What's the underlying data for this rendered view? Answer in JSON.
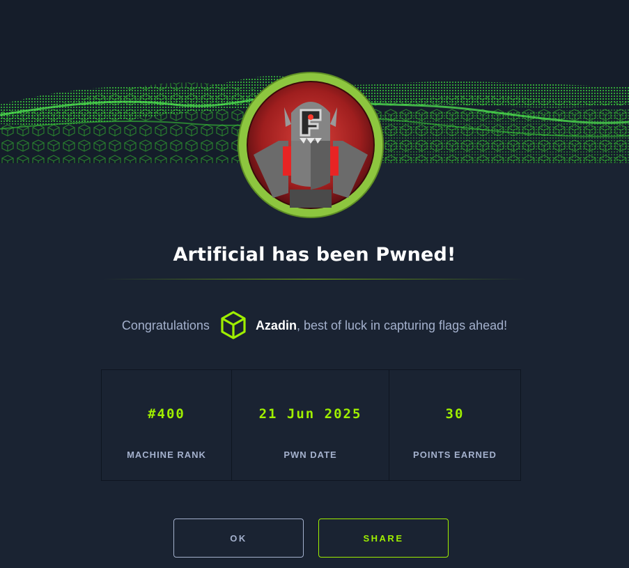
{
  "modal": {
    "title": "Artificial has been Pwned!",
    "congrats_prefix": "Congratulations",
    "username": "Azadin",
    "congrats_suffix": ", best of luck in capturing flags ahead!",
    "stats": [
      {
        "value": "#400",
        "label": "MACHINE RANK"
      },
      {
        "value": "21 Jun 2025",
        "label": "PWN DATE"
      },
      {
        "value": "30",
        "label": "POINTS EARNED"
      }
    ],
    "buttons": {
      "ok_label": "OK",
      "share_label": "SHARE"
    }
  },
  "icons": {
    "banner": "green-cube-wave-banner",
    "avatar": "robot-machine-avatar",
    "user_badge": "green-cube-icon"
  },
  "colors": {
    "background": "#1a2332",
    "accent_green": "#9fef00",
    "muted_text": "#a4b1cd",
    "avatar_ring": "#8dc63f",
    "avatar_inner": "#b82a2a"
  }
}
